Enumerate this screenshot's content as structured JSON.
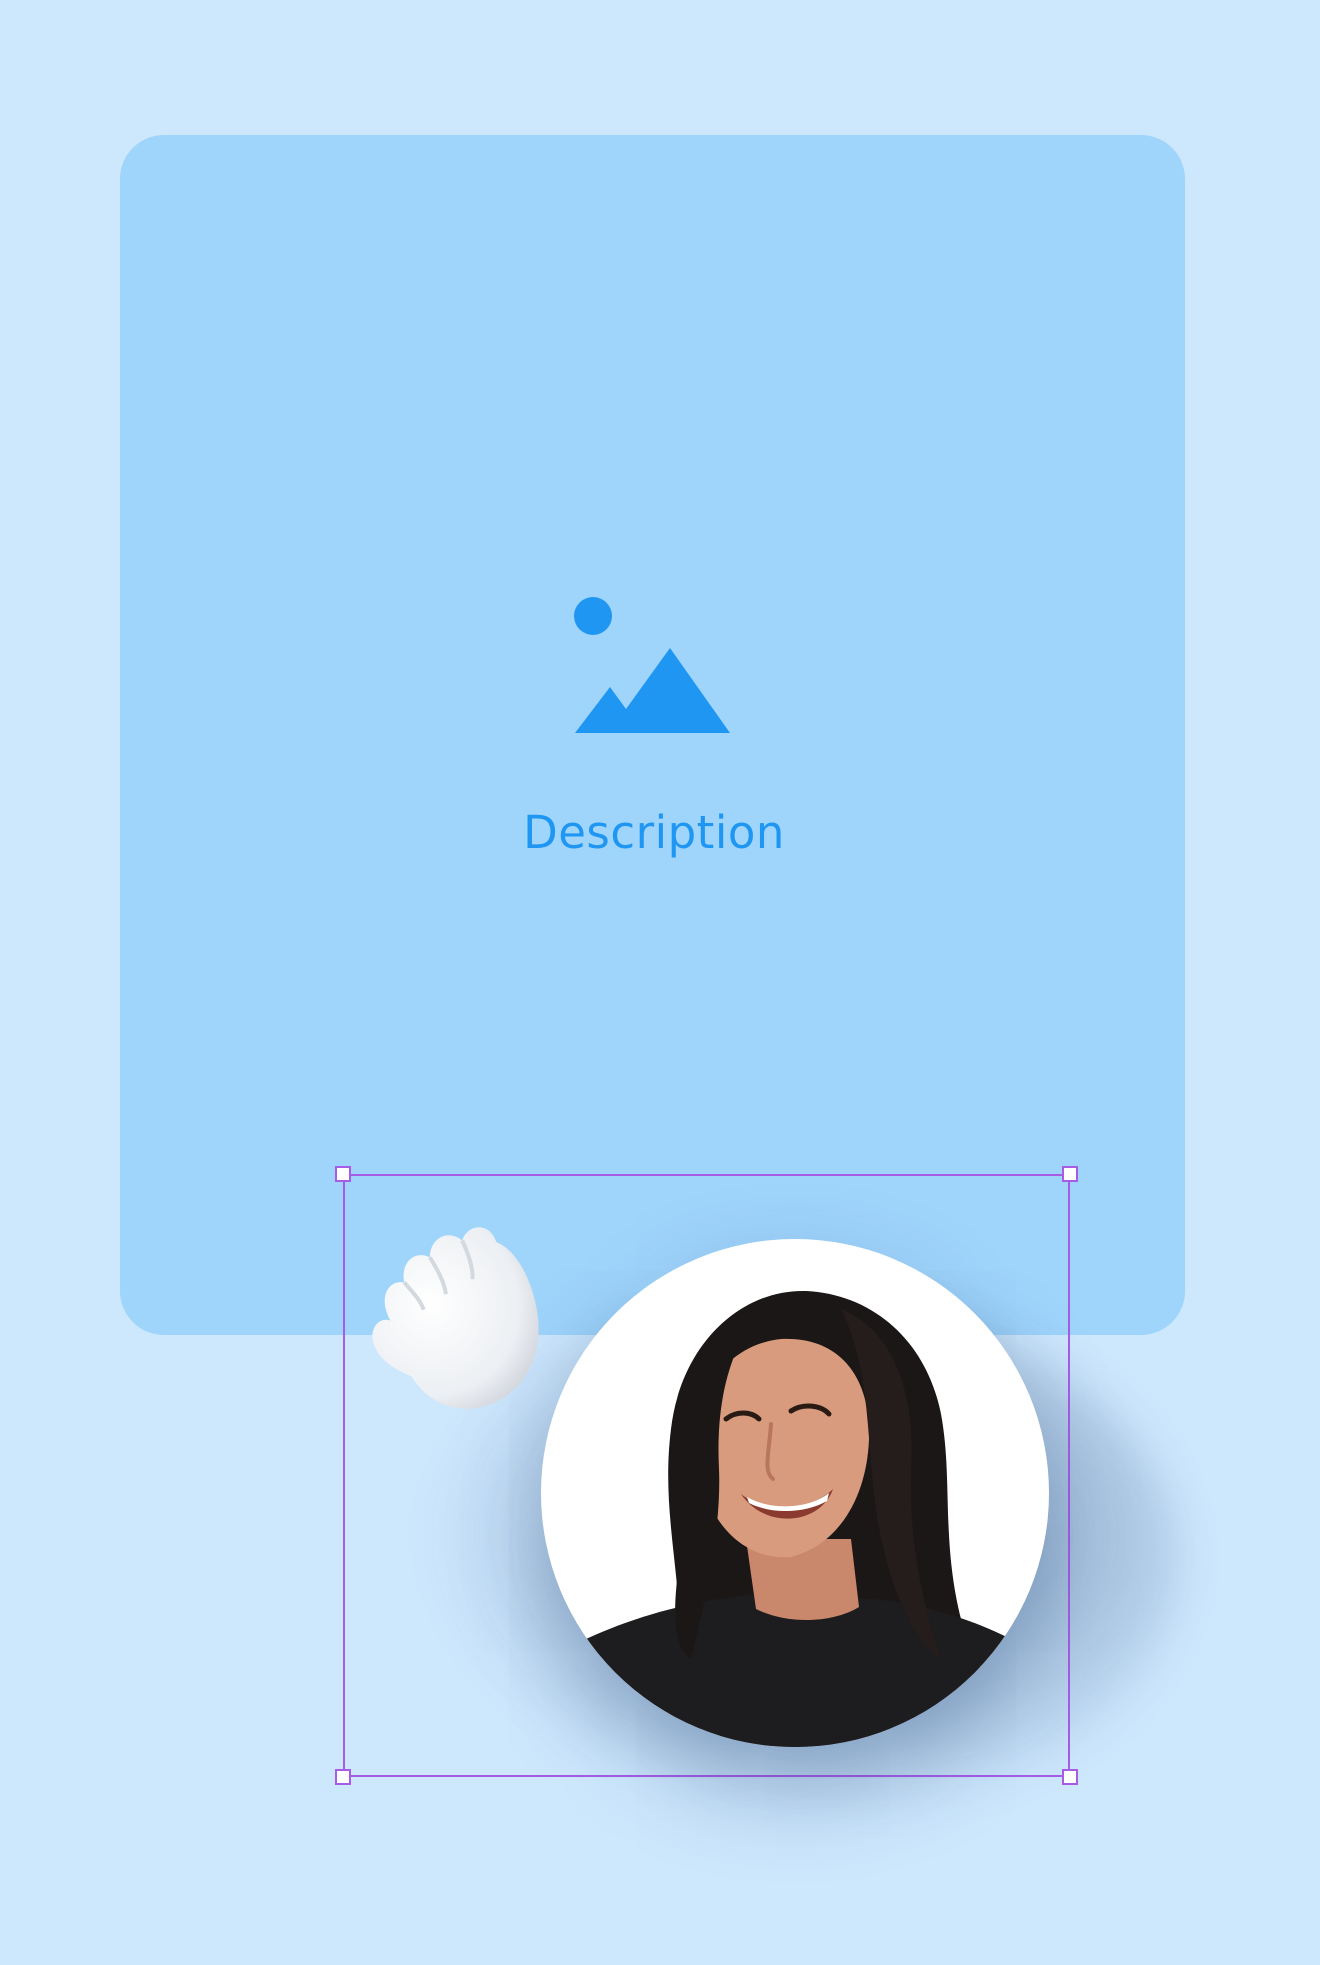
{
  "card": {
    "description": "Description",
    "icon": "image-placeholder-icon"
  },
  "avatar": {
    "icon": "person-photo"
  },
  "sticker": {
    "icon": "waving-hand-icon"
  },
  "colors": {
    "page_background": "#cde7fd",
    "card_background": "#9fd4fb",
    "accent_blue": "#1f97f2",
    "selection_purple": "#a65ce6"
  }
}
